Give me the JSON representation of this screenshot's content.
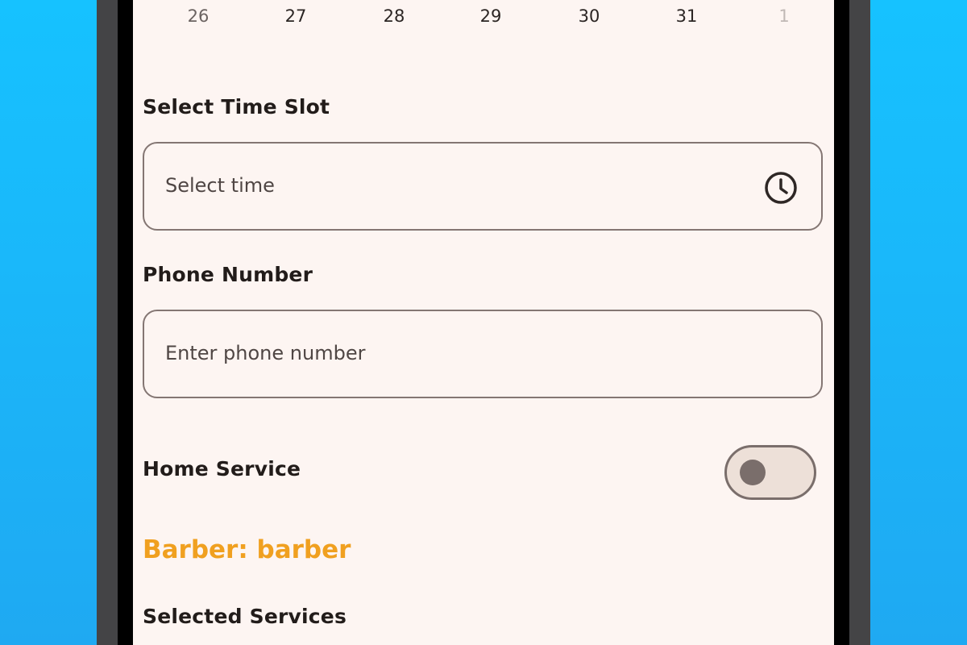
{
  "calendar": {
    "dates": [
      {
        "day": "26",
        "style": "muted"
      },
      {
        "day": "27",
        "style": "normal"
      },
      {
        "day": "28",
        "style": "normal"
      },
      {
        "day": "29",
        "style": "normal"
      },
      {
        "day": "30",
        "style": "normal"
      },
      {
        "day": "31",
        "style": "normal"
      },
      {
        "day": "1",
        "style": "faded"
      }
    ]
  },
  "time_slot": {
    "label": "Select Time Slot",
    "placeholder": "Select time",
    "icon": "clock-icon"
  },
  "phone": {
    "label": "Phone Number",
    "placeholder": "Enter phone number"
  },
  "home_service": {
    "label": "Home Service",
    "enabled": false
  },
  "barber": {
    "text": "Barber: barber",
    "color": "#f0a020"
  },
  "selected_services": {
    "label": "Selected Services"
  },
  "colors": {
    "background": "#16c2ff",
    "screen": "#fdf5f2",
    "text": "#221c1a",
    "accent": "#f0a020"
  }
}
